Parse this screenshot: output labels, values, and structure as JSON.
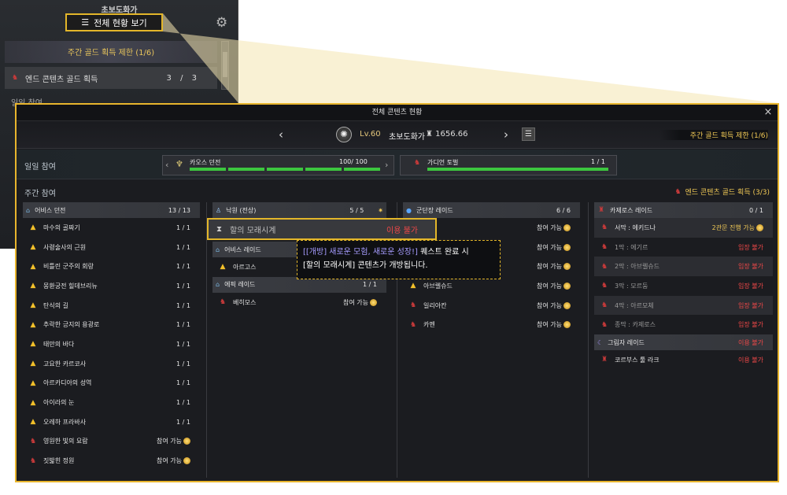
{
  "mini_panel": {
    "character": "초보도화가",
    "overview_button": "전체 현황 보기",
    "weekly_limit": "주간 골드 획득 제한 (1/6)",
    "endgold_label": "엔드 콘텐츠 골드 획득",
    "endgold_count": "3 / 3",
    "daily_partial": "일일 참여"
  },
  "modal": {
    "title": "전체 콘텐츠 현황",
    "close": "×",
    "character": {
      "level": "Lv.60",
      "name": "초보도화가",
      "item_level": "1656.66"
    },
    "prev": "‹",
    "next": "›",
    "weekly_limit": "주간 골드 획득 제한 (1/6)",
    "daily_label": "일일 참여",
    "daily": [
      {
        "name": "카오스 던전",
        "value": "100/ 100"
      },
      {
        "name": "가디언 토벌",
        "value": "1 / 1"
      }
    ],
    "weekly_label": "주간 참여",
    "endgold_label": "엔드 콘텐츠 골드 획득 (3/3)"
  },
  "col1": {
    "category": {
      "name": "어비스 던전",
      "value": "13 / 13"
    },
    "items": [
      {
        "name": "마수의 골짜기",
        "value": "1 / 1",
        "icon": "warn"
      },
      {
        "name": "사령술사의 근원",
        "value": "1 / 1",
        "icon": "warn"
      },
      {
        "name": "비틀린 군주의 회랑",
        "value": "1 / 1",
        "icon": "warn"
      },
      {
        "name": "몽환궁전 힐데브리뉴",
        "value": "1 / 1",
        "icon": "warn"
      },
      {
        "name": "탄식의 길",
        "value": "1 / 1",
        "icon": "warn"
      },
      {
        "name": "추락한 긍지의 용광로",
        "value": "1 / 1",
        "icon": "warn"
      },
      {
        "name": "태만의 바다",
        "value": "1 / 1",
        "icon": "warn"
      },
      {
        "name": "고요한 카르코사",
        "value": "1 / 1",
        "icon": "warn"
      },
      {
        "name": "아르카디아의 성역",
        "value": "1 / 1",
        "icon": "warn"
      },
      {
        "name": "아이라의 눈",
        "value": "1 / 1",
        "icon": "warn"
      },
      {
        "name": "오레하 프라바사",
        "value": "1 / 1",
        "icon": "warn"
      },
      {
        "name": "영원한 빛의 요람",
        "value": "참여 가능",
        "icon": "demon"
      },
      {
        "name": "짓밟힌 정원",
        "value": "참여 가능",
        "icon": "demon"
      }
    ]
  },
  "col2": {
    "paradise": {
      "name": "낙원 (전상)",
      "value": "5 / 5"
    },
    "hourglass": {
      "name": "할의 모래시계",
      "value": "이용 불가"
    },
    "abyss_raid": {
      "name": "어비스 레이드"
    },
    "argos": {
      "name": "아르고스"
    },
    "epic_raid": {
      "name": "에픽 레이드",
      "value": "1 / 1"
    },
    "behemoth": {
      "name": "베히모스",
      "value": "참여 가능"
    }
  },
  "col3": {
    "category": {
      "name": "군단장 레이드",
      "value": "6 / 6"
    },
    "items": [
      {
        "name": "",
        "value": "참여 가능"
      },
      {
        "name": "",
        "value": "참여 가능"
      },
      {
        "name": "",
        "value": "참여 가능"
      },
      {
        "name": "아브렐슈드",
        "value": "참여 가능",
        "icon": "warn"
      },
      {
        "name": "일리아칸",
        "value": "참여 가능",
        "icon": "demon"
      },
      {
        "name": "카멘",
        "value": "참여 가능",
        "icon": "demon"
      }
    ]
  },
  "col4": {
    "category": {
      "name": "카제로스 레이드",
      "value": "0 / 1"
    },
    "items": [
      {
        "name": "서막 : 에키드나",
        "value": "2관문 진행 가능",
        "state": "gold",
        "shade": true
      },
      {
        "name": "1막 : 에기르",
        "value": "입장 불가",
        "state": "red"
      },
      {
        "name": "2막 : 아브렐슈드",
        "value": "입장 불가",
        "state": "red",
        "shade": true
      },
      {
        "name": "3막 : 모르둠",
        "value": "입장 불가",
        "state": "red"
      },
      {
        "name": "4막 : 아르모체",
        "value": "입장 불가",
        "state": "red",
        "shade": true
      },
      {
        "name": "종막 : 카제로스",
        "value": "입장 불가",
        "state": "red"
      }
    ],
    "shadow": {
      "name": "그림자 레이드",
      "value": "이용 불가"
    },
    "kouku": {
      "name": "코르부스 툴 라크",
      "value": "이용 불가"
    }
  },
  "tooltip": {
    "part1": "[[개방] 새로운 모험, 새로운 성장!]",
    "part2": " 퀘스트 완료 시",
    "line2": "[할의 모래시계] 콘텐츠가 개방됩니다."
  },
  "colors": {
    "accent": "#e3b62a",
    "gold": "#f1c956",
    "red": "#f04848",
    "green": "#3cc63f"
  }
}
